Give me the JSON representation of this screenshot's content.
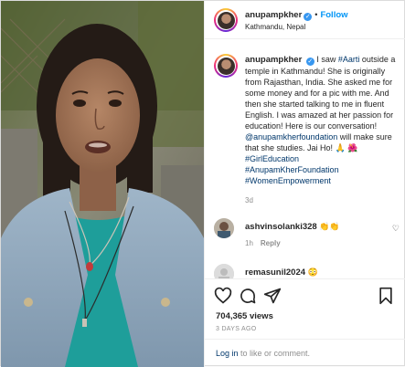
{
  "post": {
    "username": "anupampkher",
    "verified_glyph": "✓",
    "separator": "•",
    "follow_label": "Follow",
    "location": "Kathmandu, Nepal",
    "caption": {
      "part1": " I saw ",
      "hashtag_aarti": "#Aarti",
      "part2": " outside a temple in Kathmandu! She is originally from Rajasthan, India. She asked me for some money and for a pic with me. And then she started talking to me in fluent English. I was amazed at her passion for education! Here is our conversation! ",
      "mention": "@anupamkherfoundation",
      "part3": " will make sure that she studies. Jai Ho! 🙏 🌺",
      "tags": [
        "#GirlEducation",
        "#AnupamKherFoundation",
        "#WomenEmpowerment"
      ]
    },
    "posted_short": "3d",
    "comments": [
      {
        "username": "ashvinsolanki328",
        "text": "👏👏",
        "time": "1h",
        "reply_label": "Reply"
      },
      {
        "username": "remasunil2024",
        "text": "😳"
      }
    ],
    "views": "704,365 views",
    "posted_ago": "3 DAYS AGO",
    "login": {
      "link": "Log in",
      "rest": " to like or comment."
    },
    "icons": [
      "heart-icon",
      "comment-icon",
      "share-icon",
      "bookmark-icon"
    ],
    "colors": {
      "link": "#00376b",
      "follow": "#0095f6",
      "verified": "#3897f0"
    }
  }
}
